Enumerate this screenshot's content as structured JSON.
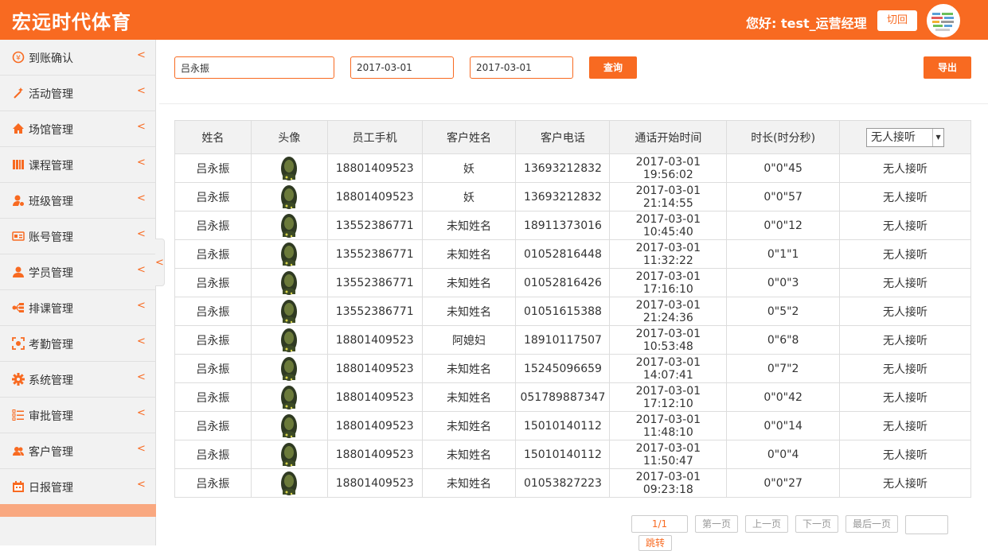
{
  "header": {
    "brand": "宏远时代体育",
    "greeting": "您好: test_运营经理",
    "switch_label": "切回"
  },
  "sidebar": {
    "items": [
      {
        "label": "到账确认",
        "icon": "yen-circle-icon"
      },
      {
        "label": "活动管理",
        "icon": "magic-wand-icon"
      },
      {
        "label": "场馆管理",
        "icon": "home-icon"
      },
      {
        "label": "课程管理",
        "icon": "books-icon"
      },
      {
        "label": "班级管理",
        "icon": "user-pin-icon"
      },
      {
        "label": "账号管理",
        "icon": "id-card-icon"
      },
      {
        "label": "学员管理",
        "icon": "user-icon"
      },
      {
        "label": "排课管理",
        "icon": "share-nodes-icon"
      },
      {
        "label": "考勤管理",
        "icon": "scan-icon"
      },
      {
        "label": "系统管理",
        "icon": "gear-icon"
      },
      {
        "label": "审批管理",
        "icon": "checklist-icon"
      },
      {
        "label": "客户管理",
        "icon": "users-icon"
      },
      {
        "label": "日报管理",
        "icon": "calendar-icon"
      }
    ],
    "chevron": "<",
    "collapse": "<"
  },
  "filters": {
    "name_value": "吕永振",
    "start_date": "2017-03-01",
    "end_date": "2017-03-01",
    "search_label": "查询",
    "export_label": "导出"
  },
  "table": {
    "columns": [
      "姓名",
      "头像",
      "员工手机",
      "客户姓名",
      "客户电话",
      "通话开始时间",
      "时长(时分秒)"
    ],
    "status_filter": "无人接听",
    "rows": [
      {
        "name": "吕永振",
        "phone": "18801409523",
        "customer": "妖",
        "cust_phone": "13693212832",
        "start": "2017-03-01 19:56:02",
        "duration": "0\"0\"45",
        "status": "无人接听"
      },
      {
        "name": "吕永振",
        "phone": "18801409523",
        "customer": "妖",
        "cust_phone": "13693212832",
        "start": "2017-03-01 21:14:55",
        "duration": "0\"0\"57",
        "status": "无人接听"
      },
      {
        "name": "吕永振",
        "phone": "13552386771",
        "customer": "未知姓名",
        "cust_phone": "18911373016",
        "start": "2017-03-01 10:45:40",
        "duration": "0\"0\"12",
        "status": "无人接听"
      },
      {
        "name": "吕永振",
        "phone": "13552386771",
        "customer": "未知姓名",
        "cust_phone": "01052816448",
        "start": "2017-03-01 11:32:22",
        "duration": "0\"1\"1",
        "status": "无人接听"
      },
      {
        "name": "吕永振",
        "phone": "13552386771",
        "customer": "未知姓名",
        "cust_phone": "01052816426",
        "start": "2017-03-01 17:16:10",
        "duration": "0\"0\"3",
        "status": "无人接听"
      },
      {
        "name": "吕永振",
        "phone": "13552386771",
        "customer": "未知姓名",
        "cust_phone": "01051615388",
        "start": "2017-03-01 21:24:36",
        "duration": "0\"5\"2",
        "status": "无人接听"
      },
      {
        "name": "吕永振",
        "phone": "18801409523",
        "customer": "阿媳妇",
        "cust_phone": "18910117507",
        "start": "2017-03-01 10:53:48",
        "duration": "0\"6\"8",
        "status": "无人接听"
      },
      {
        "name": "吕永振",
        "phone": "18801409523",
        "customer": "未知姓名",
        "cust_phone": "15245096659",
        "start": "2017-03-01 14:07:41",
        "duration": "0\"7\"2",
        "status": "无人接听"
      },
      {
        "name": "吕永振",
        "phone": "18801409523",
        "customer": "未知姓名",
        "cust_phone": "051789887347",
        "start": "2017-03-01 17:12:10",
        "duration": "0\"0\"42",
        "status": "无人接听"
      },
      {
        "name": "吕永振",
        "phone": "18801409523",
        "customer": "未知姓名",
        "cust_phone": "15010140112",
        "start": "2017-03-01 11:48:10",
        "duration": "0\"0\"14",
        "status": "无人接听"
      },
      {
        "name": "吕永振",
        "phone": "18801409523",
        "customer": "未知姓名",
        "cust_phone": "15010140112",
        "start": "2017-03-01 11:50:47",
        "duration": "0\"0\"4",
        "status": "无人接听"
      },
      {
        "name": "吕永振",
        "phone": "18801409523",
        "customer": "未知姓名",
        "cust_phone": "01053827223",
        "start": "2017-03-01 09:23:18",
        "duration": "0\"0\"27",
        "status": "无人接听"
      }
    ]
  },
  "pager": {
    "current": "1/1",
    "first": "第一页",
    "prev": "上一页",
    "next": "下一页",
    "last": "最后一页",
    "jump": "跳转"
  },
  "colors": {
    "accent": "#f86a21",
    "sidebar_bg": "#f2f2f2",
    "active_item": "#f9a880"
  }
}
